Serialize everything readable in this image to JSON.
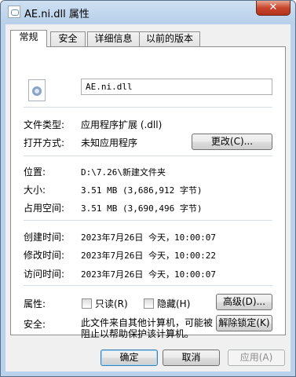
{
  "window": {
    "title": "AE.ni.dll 属性",
    "close_label": "✕"
  },
  "tabs": [
    {
      "label": "常规",
      "active": true
    },
    {
      "label": "安全",
      "active": false
    },
    {
      "label": "详细信息",
      "active": false
    },
    {
      "label": "以前的版本",
      "active": false
    }
  ],
  "general": {
    "file_name": "AE.ni.dll",
    "file_type_label": "文件类型:",
    "file_type_value": "应用程序扩展 (.dll)",
    "opens_with_label": "打开方式:",
    "opens_with_value": "未知应用程序",
    "change_button": "更改(C)...",
    "location_label": "位置:",
    "location_value": "D:\\7.26\\新建文件夹",
    "size_label": "大小:",
    "size_value": "3.51 MB (3,686,912 字节)",
    "size_on_disk_label": "占用空间:",
    "size_on_disk_value": "3.51 MB (3,690,496 字节)",
    "created_label": "创建时间:",
    "created_value": "2023年7月26日 今天，10:00:07",
    "modified_label": "修改时间:",
    "modified_value": "2023年7月26日 今天，10:00:22",
    "accessed_label": "访问时间:",
    "accessed_value": "2023年7月26日 今天，10:00:07",
    "attributes_label": "属性:",
    "readonly_label": "只读(R)",
    "hidden_label": "隐藏(H)",
    "advanced_button": "高级(D)...",
    "security_label": "安全:",
    "security_text": "此文件来自其他计算机，可能被阻止以帮助保护该计算机。",
    "unblock_button": "解除锁定(K)"
  },
  "footer": {
    "ok": "确定",
    "cancel": "取消",
    "apply": "应用(A)"
  },
  "colors": {
    "frame": "#b9d1ea",
    "close": "#c8452c",
    "default_button_border": "#3c7fb1"
  }
}
